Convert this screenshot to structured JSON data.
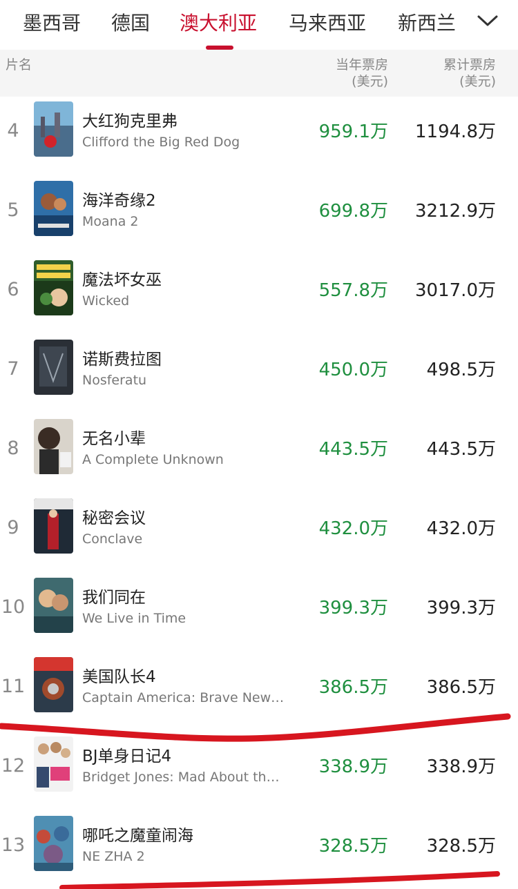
{
  "tabs": [
    {
      "label": "墨西哥",
      "active": false
    },
    {
      "label": "德国",
      "active": false
    },
    {
      "label": "澳大利亚",
      "active": true
    },
    {
      "label": "马来西亚",
      "active": false
    },
    {
      "label": "新西兰",
      "active": false
    }
  ],
  "colors": {
    "accent": "#c8102e",
    "year_value": "#1f8f3f",
    "marker_line": "#d7161f"
  },
  "header": {
    "film": "片名",
    "year_box_line1": "当年票房",
    "year_box_line2": "(美元)",
    "total_box_line1": "累计票房",
    "total_box_line2": "(美元)"
  },
  "rows": [
    {
      "rank": "4",
      "title_cn": "大红狗克里弗",
      "title_en": "Clifford the Big Red Dog",
      "year": "959.1万",
      "total": "1194.8万"
    },
    {
      "rank": "5",
      "title_cn": "海洋奇缘2",
      "title_en": "Moana 2",
      "year": "699.8万",
      "total": "3212.9万"
    },
    {
      "rank": "6",
      "title_cn": "魔法坏女巫",
      "title_en": "Wicked",
      "year": "557.8万",
      "total": "3017.0万"
    },
    {
      "rank": "7",
      "title_cn": "诺斯费拉图",
      "title_en": "Nosferatu",
      "year": "450.0万",
      "total": "498.5万"
    },
    {
      "rank": "8",
      "title_cn": "无名小辈",
      "title_en": "A Complete Unknown",
      "year": "443.5万",
      "total": "443.5万"
    },
    {
      "rank": "9",
      "title_cn": "秘密会议",
      "title_en": "Conclave",
      "year": "432.0万",
      "total": "432.0万"
    },
    {
      "rank": "10",
      "title_cn": "我们同在",
      "title_en": "We Live in Time",
      "year": "399.3万",
      "total": "399.3万"
    },
    {
      "rank": "11",
      "title_cn": "美国队长4",
      "title_en": "Captain America: Brave New…",
      "year": "386.5万",
      "total": "386.5万"
    },
    {
      "rank": "12",
      "title_cn": "BJ单身日记4",
      "title_en": "Bridget Jones: Mad About th…",
      "year": "338.9万",
      "total": "338.9万"
    },
    {
      "rank": "13",
      "title_cn": "哪吒之魔童闹海",
      "title_en": "NE ZHA 2",
      "year": "328.5万",
      "total": "328.5万"
    }
  ]
}
